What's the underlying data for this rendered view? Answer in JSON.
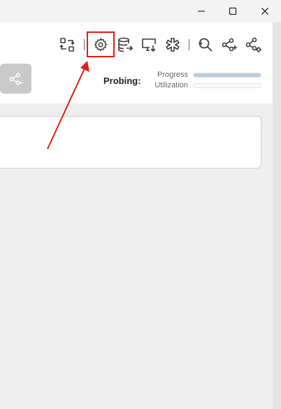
{
  "window_controls": {
    "minimize_icon": "minimize-icon",
    "maximize_icon": "maximize-icon",
    "close_icon": "close-icon"
  },
  "toolbar": {
    "tools": [
      "swap-icon",
      "gear-icon",
      "database-export-icon",
      "monitor-download-icon",
      "asterisk-icon",
      "search-icon",
      "share-add-icon",
      "share-settings-icon"
    ]
  },
  "probing": {
    "label": "Probing:",
    "progress_label": "Progress",
    "utilization_label": "Utilization",
    "progress_value": 1.0,
    "utilization_value": 0.0
  },
  "colors": {
    "highlight": "#e11d0e",
    "progress_fill": "#b8cde0"
  }
}
